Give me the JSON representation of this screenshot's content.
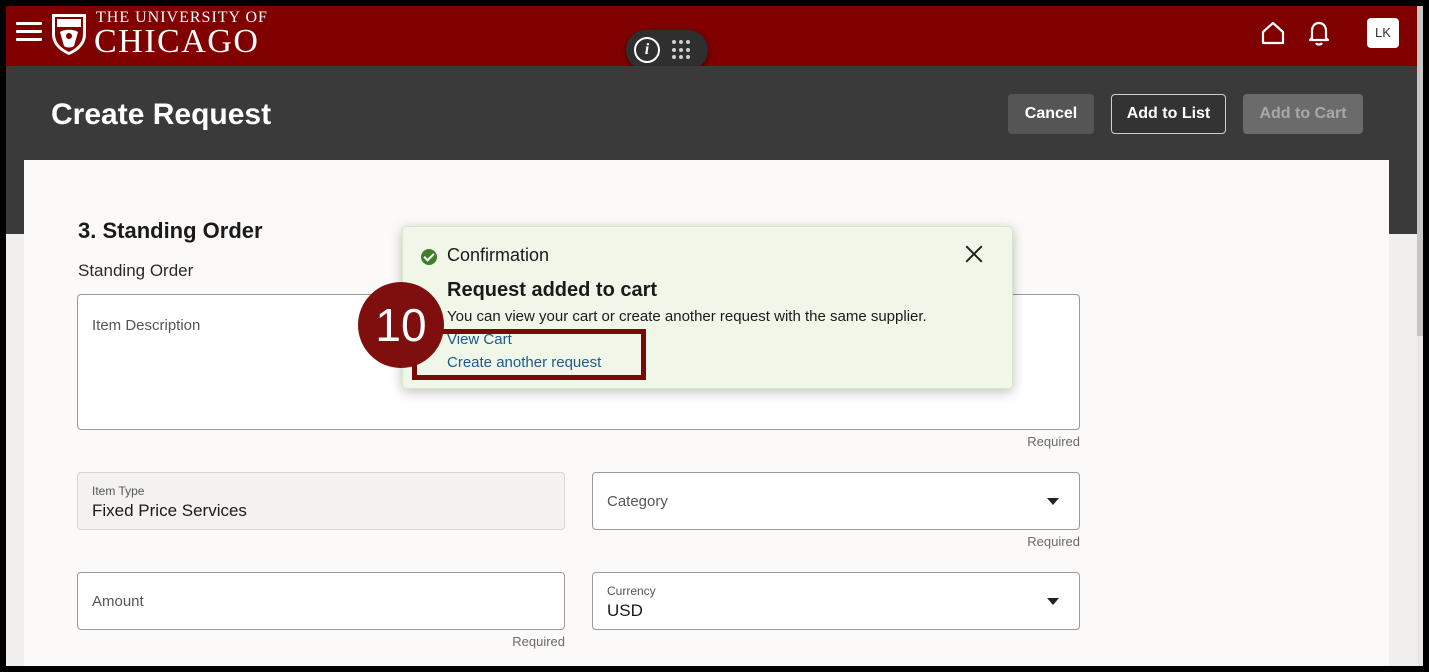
{
  "brand": {
    "top_line": "THE UNIVERSITY OF",
    "main_line": "CHICAGO",
    "color": "#800000"
  },
  "header": {
    "avatar_initials": "LK",
    "icons": [
      "menu-icon",
      "info-icon",
      "apps-grid-icon",
      "home-icon",
      "bell-icon"
    ]
  },
  "page": {
    "title": "Create Request",
    "buttons": {
      "cancel": "Cancel",
      "add_to_list": "Add to List",
      "add_to_cart": "Add to Cart"
    }
  },
  "form": {
    "section_title": "3. Standing Order",
    "section_subtitle": "Standing Order",
    "item_description": {
      "label": "Item Description",
      "required": "Required"
    },
    "item_type": {
      "label": "Item Type",
      "value": "Fixed Price Services"
    },
    "category": {
      "label": "Category",
      "required": "Required"
    },
    "amount": {
      "label": "Amount",
      "required": "Required"
    },
    "currency": {
      "label": "Currency",
      "value": "USD"
    }
  },
  "confirmation": {
    "heading": "Confirmation",
    "title": "Request added to cart",
    "message": "You can view your cart or create another request with the same supplier.",
    "links": {
      "view_cart": "View Cart",
      "create_another": "Create another request"
    },
    "background": "#f0f7e9",
    "success_color": "#3f7f2a"
  },
  "tutorial": {
    "step_number": "10",
    "marker_color": "#7f0f0f"
  }
}
